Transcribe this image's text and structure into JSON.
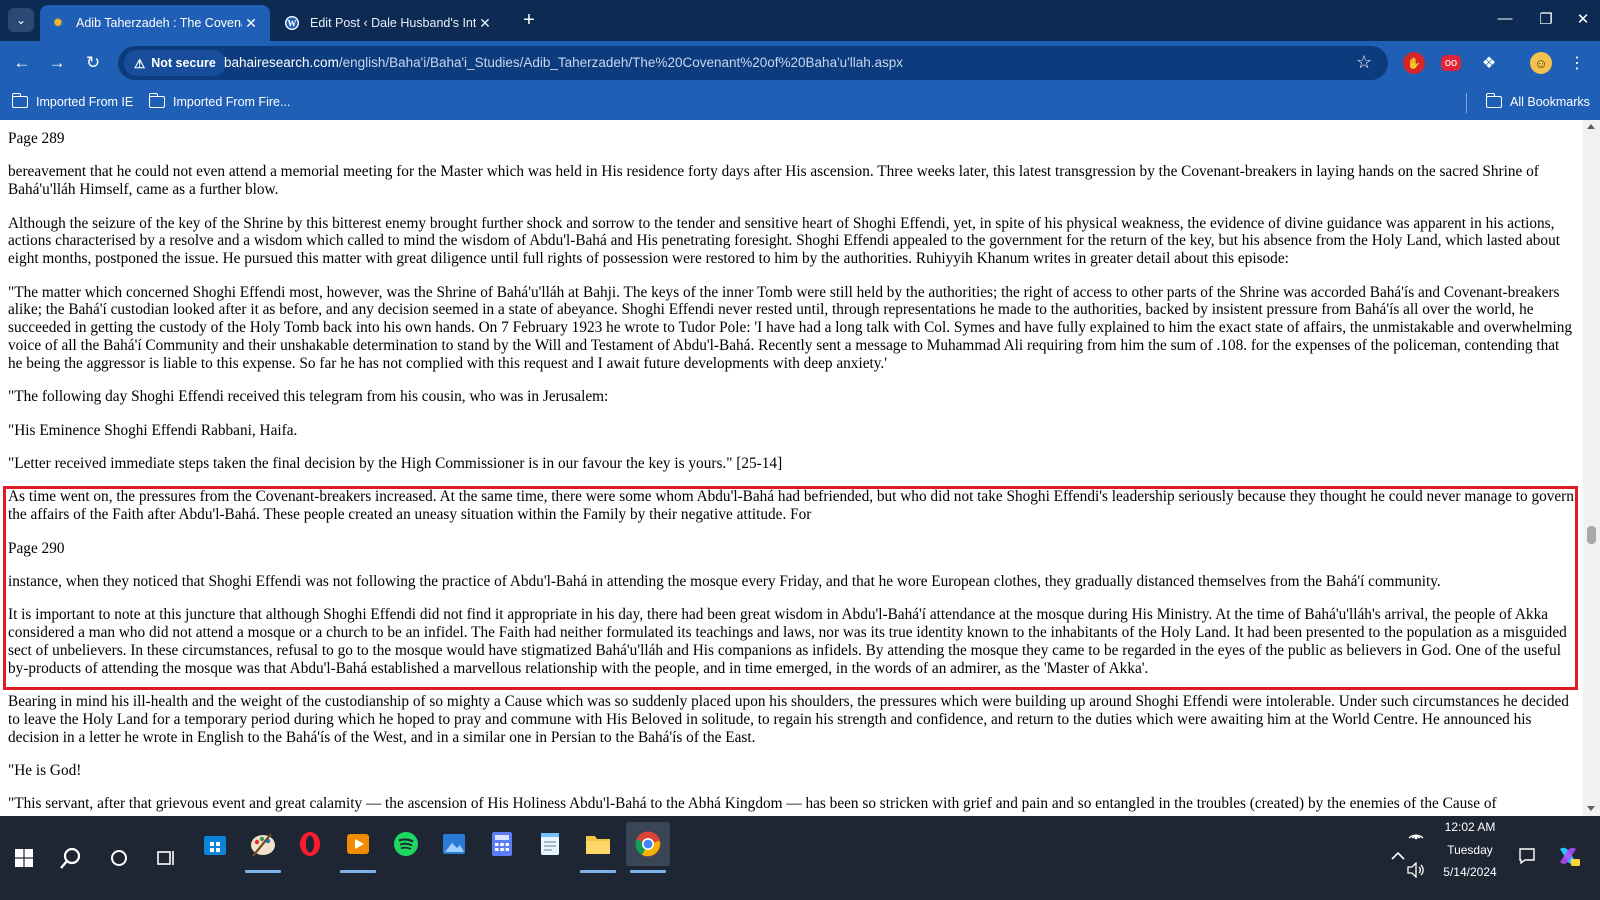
{
  "browser": {
    "tabs": [
      {
        "title": "Adib Taherzadeh : The Covenan",
        "icon": "bahai-star-icon",
        "active": true
      },
      {
        "title": "Edit Post ‹ Dale Husband's Intell",
        "icon": "wordpress-icon",
        "active": false
      }
    ],
    "security_label": "Not secure",
    "url_host": "bahairesearch.com",
    "url_path": "/english/Baha'i/Baha'i_Studies/Adib_Taherzadeh/The%20Covenant%20of%20Baha'u'llah.aspx",
    "bookmarks": [
      "Imported From IE",
      "Imported From Fire..."
    ],
    "all_bookmarks_label": "All Bookmarks",
    "extension_badge": "oo"
  },
  "page": {
    "paragraphs_before": [
      "Page 289",
      "bereavement that he could not even attend a memorial meeting for the Master which was held in His residence forty days after His ascension. Three weeks later, this latest transgression by the Covenant-breakers in laying hands on the sacred Shrine of Bahá'u'lláh Himself, came as a further blow.",
      "Although the seizure of the key of the Shrine by this bitterest enemy brought further shock and sorrow to the tender and sensitive heart of Shoghi Effendi, yet, in spite of his physical weakness, the evidence of divine guidance was apparent in his actions, actions characterised by a resolve and a wisdom which called to mind the wisdom of Abdu'l-Bahá and His penetrating foresight. Shoghi Effendi appealed to the government for the return of the key, but his absence from the Holy Land, which lasted about eight months, postponed the issue. He pursued this matter with great diligence until full rights of possession were restored to him by the authorities. Ruhiyyih Khanum writes in greater detail about this episode:",
      "\"The matter which concerned Shoghi Effendi most, however, was the Shrine of Bahá'u'lláh at Bahji. The keys of the inner Tomb were still held by the authorities; the right of access to other parts of the Shrine was accorded Bahá'ís and Covenant-breakers alike; the Bahá'í custodian looked after it as before, and any decision seemed in a state of abeyance. Shoghi Effendi never rested until, through representations he made to the authorities, backed by insistent pressure from Bahá'ís all over the world, he succeeded in getting the custody of the Holy Tomb back into his own hands. On 7 February 1923 he wrote to Tudor Pole: 'I have had a long talk with Col. Symes and have fully explained to him the exact state of affairs, the unmistakable and overwhelming voice of all the Bahá'í Community and their unshakable determination to stand by the Will and Testament of Abdu'l-Bahá. Recently sent a message to Muhammad Ali requiring from him the sum of .108. for the expenses of the policeman, contending that he being the aggressor is liable to this expense. So far he has not complied with this request and I await future developments with deep anxiety.'",
      "\"The following day Shoghi Effendi received this telegram from his cousin, who was in Jerusalem:",
      "\"His Eminence Shoghi Effendi Rabbani, Haifa.",
      "\"Letter received immediate steps taken the final decision by the High Commissioner is in our favour the key is yours.\" [25-14]"
    ],
    "paragraphs_highlighted": [
      "As time went on, the pressures from the Covenant-breakers increased. At the same time, there were some whom Abdu'l-Bahá had befriended, but who did not take Shoghi Effendi's leadership seriously because they thought he could never manage to govern the affairs of the Faith after Abdu'l-Bahá. These people created an uneasy situation within the Family by their negative attitude. For",
      "Page 290",
      "instance, when they noticed that Shoghi Effendi was not following the practice of Abdu'l-Bahá in attending the mosque every Friday, and that he wore European clothes, they gradually distanced themselves from the Bahá'í community.",
      "It is important to note at this juncture that although Shoghi Effendi did not find it appropriate in his day, there had been great wisdom in Abdu'l-Bahá'í attendance at the mosque during His Ministry. At the time of Bahá'u'lláh's arrival, the people of Akka considered a man who did not attend a mosque or a church to be an infidel. The Faith had neither formulated its teachings and laws, nor was its true identity known to the inhabitants of the Holy Land. It had been presented to the population as a misguided sect of unbelievers. In these circumstances, refusal to go to the mosque would have stigmatized Bahá'u'lláh and His companions as infidels. By attending the mosque they came to be regarded in the eyes of the public as believers in God. One of the useful by-products of attending the mosque was that Abdu'l-Bahá established a marvellous relationship with the people, and in time emerged, in the words of an admirer, as the 'Master of Akka'."
    ],
    "paragraphs_after": [
      "Bearing in mind his ill-health and the weight of the custodianship of so mighty a Cause which was so suddenly placed upon his shoulders, the pressures which were building up around Shoghi Effendi were intolerable. Under such circumstances he decided to leave the Holy Land for a temporary period during which he hoped to pray and commune with His Beloved in solitude, to regain his strength and confidence, and return to the duties which were awaiting him at the World Centre. He announced his decision in a letter he wrote in English to the Bahá'ís of the West, and in a similar one in Persian to the Bahá'ís of the East.",
      "\"He is God!",
      "\"This servant, after that grievous event and great calamity — the ascension of His Holiness Abdu'l-Bahá to the Abhá Kingdom — has been so stricken with grief and pain and so entangled in the troubles (created) by the enemies of the Cause of"
    ],
    "highlight_color": "#e01b24"
  },
  "taskbar": {
    "apps": [
      "windows-start-icon",
      "search-icon",
      "cortana-icon",
      "task-view-icon",
      "store-icon",
      "paint-icon",
      "opera-icon",
      "media-player-icon",
      "spotify-icon",
      "photos-icon",
      "calculator-icon",
      "notepad-icon",
      "file-explorer-icon",
      "chrome-icon"
    ],
    "time": "12:02 AM",
    "day": "Tuesday",
    "date": "5/14/2024"
  },
  "colors": {
    "tabstrip": "#0c2a52",
    "toolbar": "#1f5fb6",
    "taskbar": "#1e2633"
  }
}
